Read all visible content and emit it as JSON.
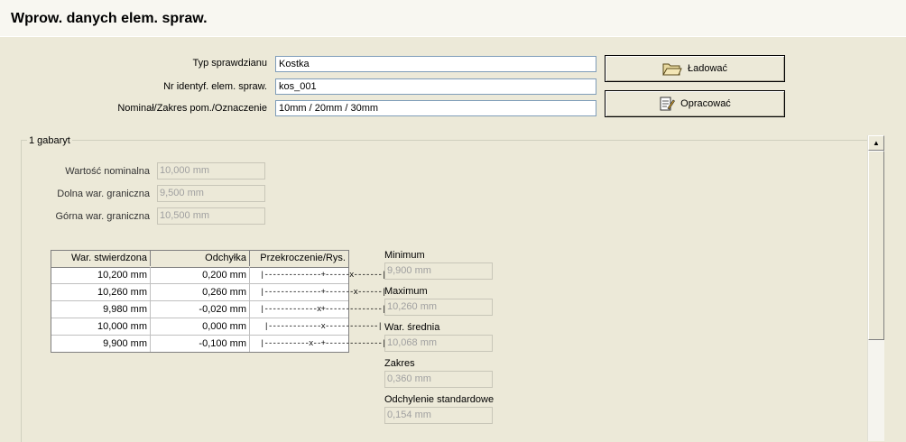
{
  "window": {
    "title": "Wprow. danych elem. spraw."
  },
  "form": {
    "type_label": "Typ sprawdzianu",
    "type_value": "Kostka",
    "id_label": "Nr identyf. elem. spraw.",
    "id_value": "kos_001",
    "nominal_label": "Nominał/Zakres pom./Oznaczenie",
    "nominal_value": "10mm / 20mm / 30mm"
  },
  "buttons": {
    "load_label": "Ładować",
    "load_icon": "folder-open-icon",
    "process_label": "Opracować",
    "process_icon": "edit-document-icon"
  },
  "group": {
    "legend": "1 gabaryt",
    "nominal_label": "Wartość nominalna",
    "nominal_value": "10,000 mm",
    "lower_label": "Dolna war. graniczna",
    "lower_value": "9,500 mm",
    "upper_label": "Górna war. graniczna",
    "upper_value": "10,500 mm"
  },
  "table": {
    "headers": [
      "War. stwierdzona",
      "Odchyłka",
      "Przekroczenie/Rys."
    ],
    "rows": [
      {
        "value": "10,200 mm",
        "deviation": "0,200 mm",
        "graph": "|--------------+------x-------|"
      },
      {
        "value": "10,260 mm",
        "deviation": "0,260 mm",
        "graph": "|--------------+-------x------|"
      },
      {
        "value": "9,980 mm",
        "deviation": "-0,020 mm",
        "graph": "|-------------x+--------------|"
      },
      {
        "value": "10,000 mm",
        "deviation": "0,000 mm",
        "graph": " |-------------x-------------|"
      },
      {
        "value": "9,900 mm",
        "deviation": "-0,100 mm",
        "graph": "|-----------x--+--------------|"
      }
    ]
  },
  "stats": {
    "min_label": "Minimum",
    "min_value": "9,900 mm",
    "max_label": "Maximum",
    "max_value": "10,260 mm",
    "mean_label": "War. średnia",
    "mean_value": "10,068 mm",
    "range_label": "Zakres",
    "range_value": "0,360 mm",
    "std_label": "Odchylenie standardowe",
    "std_value": "0,154 mm"
  }
}
